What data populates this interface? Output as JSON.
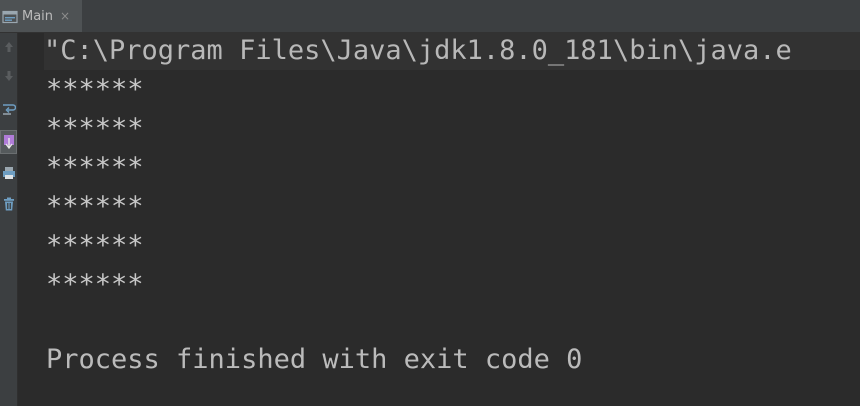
{
  "tab": {
    "label": "Main",
    "close_glyph": "×",
    "icon": "console-icon"
  },
  "toolbar": {
    "buttons": [
      {
        "name": "up-arrow-icon"
      },
      {
        "name": "down-arrow-icon"
      },
      {
        "name": "soft-wrap-icon"
      },
      {
        "name": "scroll-to-end-icon"
      },
      {
        "name": "print-icon"
      },
      {
        "name": "clear-all-icon"
      }
    ]
  },
  "console": {
    "command_line": "\"C:\\Program Files\\Java\\jdk1.8.0_181\\bin\\java.e",
    "output_lines": [
      "******",
      "******",
      "******",
      "******",
      "******",
      "******"
    ],
    "exit_message": "Process finished with exit code 0"
  },
  "colors": {
    "background": "#2b2b2b",
    "tab_bar": "#3c3f41",
    "text": "#c7c7c7",
    "command_highlight": "#323232"
  }
}
